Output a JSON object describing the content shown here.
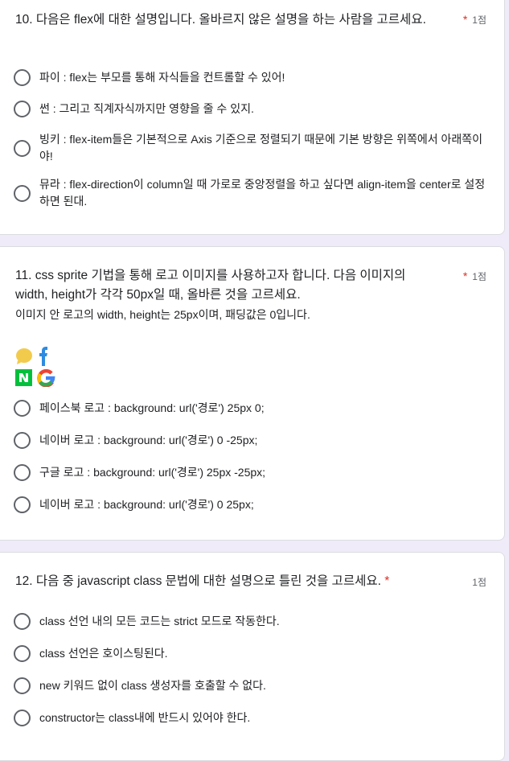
{
  "questions": [
    {
      "title": "10. 다음은 flex에 대한 설명입니다. 올바르지 않은 설명을 하는 사람을 고르세요.",
      "required": "*",
      "points": "1점",
      "options": [
        "파이 : flex는 부모를 통해 자식들을 컨트롤할 수 있어!",
        "썬 : 그리고 직계자식까지만 영향을 줄 수 있지.",
        "빙키 : flex-item들은 기본적으로 Axis 기준으로 정렬되기 때문에 기본 방향은 위쪽에서 아래쪽이야!",
        "뮤라 : flex-direction이 column일 때 가로로 중앙정렬을 하고 싶다면 align-item을 center로 설정하면 된대."
      ]
    },
    {
      "title": "11. css sprite 기법을 통해 로고 이미지를 사용하고자 합니다. 다음 이미지의 width, height가 각각 50px일 때, 올바른 것을 고르세요.",
      "subtitle": "이미지 안 로고의 width, height는 25px이며, 패딩값은 0입니다.",
      "required": "*",
      "points": "1점",
      "image_logos": [
        "kakao-talk-logo",
        "facebook-logo",
        "naver-logo",
        "google-logo"
      ],
      "options": [
        "페이스북 로고 :  background: url('경로') 25px 0;",
        "네이버 로고 :  background: url('경로') 0 -25px;",
        "구글 로고 :  background: url('경로') 25px -25px;",
        "네이버 로고 : background: url('경로') 0 25px;"
      ]
    },
    {
      "title": "12. 다음 중 javascript class 문법에 대한 설명으로 틀린 것을 고르세요.",
      "required": "*",
      "points": "1점",
      "options": [
        "class 선언 내의 모든 코드는 strict 모드로 작동한다.",
        "class 선언은 호이스팅된다.",
        "new 키워드 없이 class 생성자를 호출할 수 없다.",
        "constructor는 class내에 반드시 있어야 한다."
      ]
    }
  ]
}
